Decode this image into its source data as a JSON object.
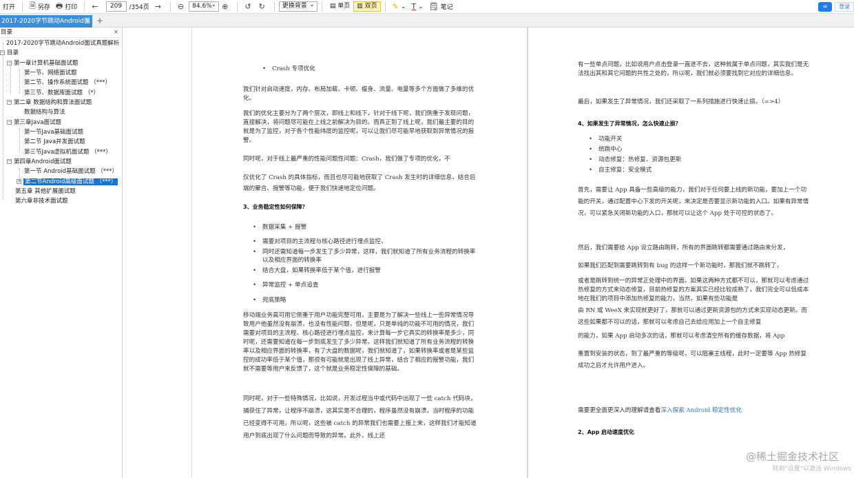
{
  "toolbar": {
    "open": "打开",
    "saveas": "另存",
    "print": "打印",
    "page_current": "209",
    "page_total": "/354页",
    "zoom": "84.6%",
    "background": "更换背景",
    "single": "单页",
    "double": "双页",
    "note": "笔记",
    "login": "登录"
  },
  "tab": {
    "title": "2017-2020字节跳动Android面",
    "close": "×"
  },
  "sidebar": {
    "header": "目录",
    "items": [
      "2017-2020字节跳动Android面试真题解析",
      "目录",
      "第一章计算机基础面试题",
      "第一节、网络面试题",
      "第二节、操作系统面试题  （***）",
      "第三节、数据库面试题  （*）",
      "第二章 数据结构和算法面试题",
      "数据结构与算法",
      "第三章Java面试题",
      "第一节Java基础面试题",
      "第二节 Java并发面试题",
      "第三节Java虚拟机面试题  （***）",
      "第四章Android面试题",
      "第一节 Android基础面试题  （***）",
      "第二节Android高级面试题  （***）",
      "第五章 其他扩展面试题",
      "第六章非技术面试题"
    ]
  },
  "left_page": {
    "b1": "Crash 专项优化",
    "p1": "我们针对启动速度，内存、布局加载、卡顿、瘦身、流量、电量等多个方面做了多维的优化。",
    "p2": "我们的优化主要分为了两个层次，即线上和线下，针对于线下呢，我们侧重于发现问题，直接解决，将问题尽可能在上线之前解决为目的。而真正到了线上呢，我们最主要的目的就是为了监控，对于各个性能纬度的监控呢，可以让我们尽可能早地获取到异常情况的报警。",
    "p3": "同时呢，对于线上最严重的性能问题性问题：Crash，我们做了专项的优化，不",
    "p4": "仅优化了 Crash 的具体指标，而且也尽可能地获取了 Crash 发生时的详细信息，结合后端的聚合、报警等功能，便于我们快速地定位问题。",
    "h1": "3、业务稳定性如何保障？",
    "b2": "数据采集 + 报警",
    "b3": "需要对项目的主流程与核心路径进行埋点监控，",
    "b4": "同时还需知道每一步发生了多少异常，这样，我们就知道了所有业务流程的转换率以及相应界面的转换率",
    "b5": "结合大盘，如果转换率低于某个值，进行报警",
    "b6": "异常监控 + 单点追查",
    "b7": "兜底策略",
    "p5": "移动端业务高可用它侧重于用户功能完整可用，主要是为了解决一些线上一些异常情况导致用户他虽然没有崩溃，也没有性能问题，但是呢，只是单纯的功能不可用的情况，我们需要对项目的主流程、核心路径进行埋点监控，来计算每一步它真实的转换率是多少，同时呢，还需要知道在每一步到底发生了多少异常。这样我们就知道了所有业务流程的转换率以及相应界面的转换率，有了大盘的数据呢，我们就知道了，如果转换率或者是某些监控的成功率低于某个值，那很有可能就是出现了线上异常，结合了相应的报警功能，我们就不需要等用户来反馈了，这个就是业务稳定性保障的基础。",
    "p6": "同时呢，对于一些特殊情况，比如说，开发过程当中或代码中出现了一些 catch 代码块，捕获住了异常，让程序不崩溃，这其实是不合理的，程序虽然没有崩溃，当时程序的功能已经变得不可用，所以呢，这些被 catch 的异常我们也需要上报上来，这样我们才能知道用户到底出现了什么问题而导致的异常。此外，线上还"
  },
  "right_page": {
    "p1": "有一些单点问题，比如说用户点击登录一直进不去，这种就属于单点问题，其实我们是无法找出其和其它问题的共性之处的，所以呢，我们就必须要找到它对应的详细信息。",
    "p2": "最后，如果发生了异常情况，我们还采取了一系列措施进行快速止损。（=>4）",
    "h1": "4、如果发生了异常情况，怎么快速止损？",
    "b1": "功能开关",
    "b2": "统跳中心",
    "b3": "动态修复：热修复、资源包更新",
    "b4": "自主修复：安全模式",
    "p3": "首先，需要让 App 具备一些高级的能力，我们对于任何要上线的新功能，要加上一个功能的开关，通过配置中心下发的开关呢，来决定是否要显示新功能的入口。如果有异常情况，可以紧急关闭新功能的入口，那就可以让这个 App 处于可控的状态了。",
    "p4": "然后，我们需要给 App 设立路由跳转，所有的界面跳转都需要通过路由来分发，",
    "p5": "如果我们匹配到需要跳转到有 bug 的这样一个新功能时，那我们就不跳转了，",
    "p6": "或者是跳转到统一的异常正处理中的界面。如果这两种方式都不可以，那就可以考虑通过热修复的方式来动态修复，目前热修复的方案其实已经比较成熟了，我们完全可以低成本地在我们的项目中添加热修复的能力，当然，如果有些功能是",
    "p7": "由 RN 或 WeeX 来实现就更好了，那就可以通过更新资源包的方式来实现动态更新。而这些如果都不可以的话，那就可以考虑自己去给应用加上一个自主修复",
    "p8": "的能力，如果 App 启动多次的话，那就可以考虑清空所有的缓存数据，将 App",
    "p9": "重置到安装的状态，到了最严重的等级呢，可以阻塞主线程，此时一定要等 App 热修复成功之后才允许用户进入。",
    "p10_a": "需要更全面更深入的理解请查看",
    "p10_link": "深入探索 Android 稳定性优化",
    "h2": "2、App 启动速度优化"
  },
  "watermark": {
    "main": "@稀土掘金技术社区",
    "sub": "转到\"设置\"以激活 Windows"
  },
  "colors": {
    "tab_active": "#3b8ed8",
    "tree_selected": "#1a73c9",
    "mode_active": "#fff3b8",
    "link": "#2f6fc4"
  }
}
